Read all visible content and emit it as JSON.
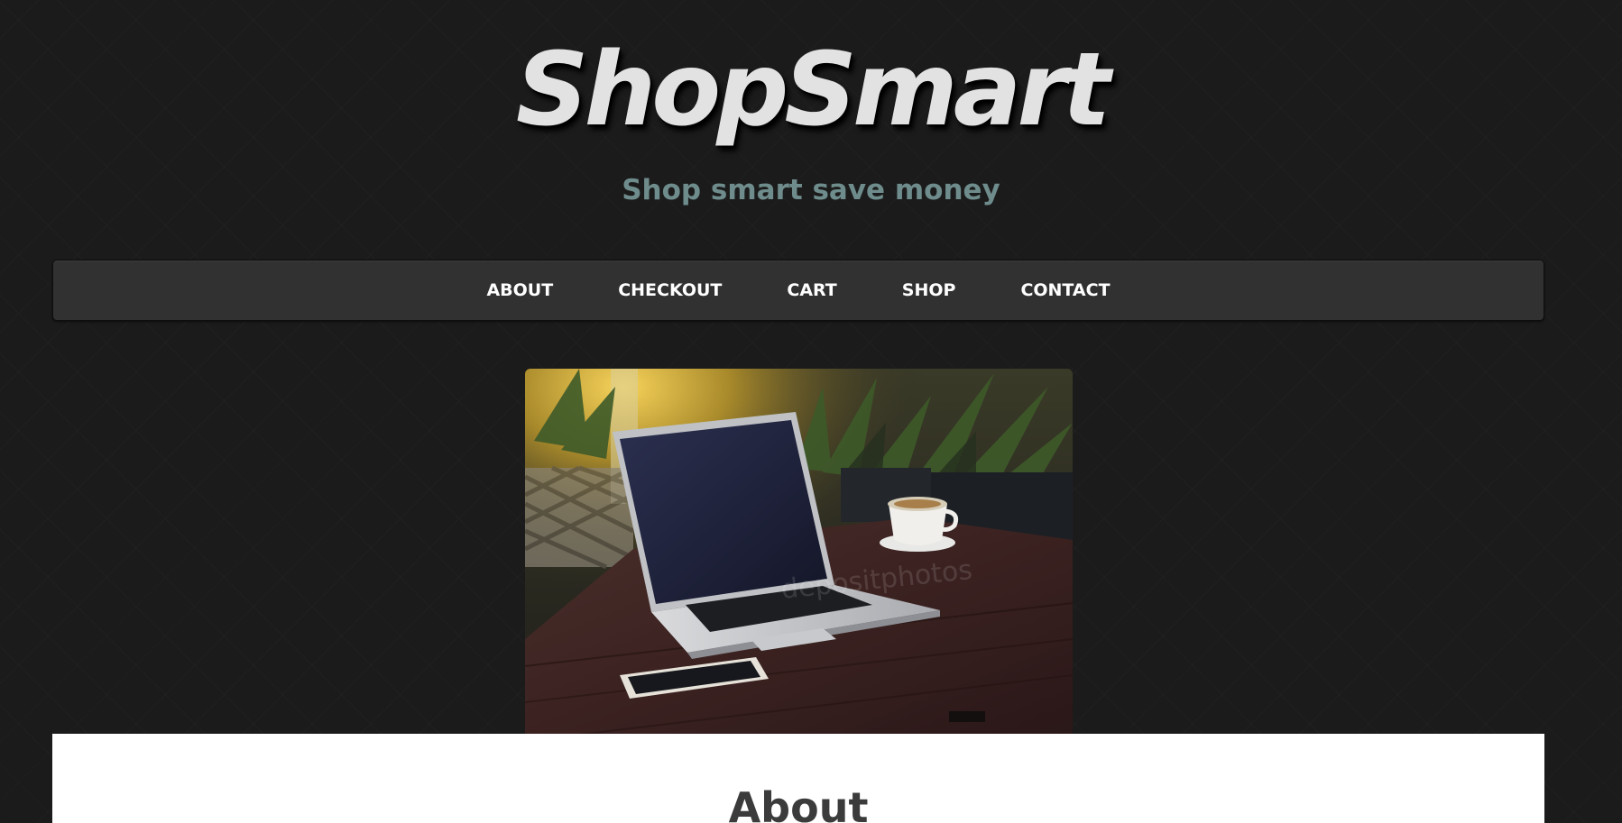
{
  "header": {
    "logo_text": "ShopSmart",
    "tagline": "Shop smart save money"
  },
  "nav": {
    "items": [
      {
        "label": "ABOUT"
      },
      {
        "label": "CHECKOUT"
      },
      {
        "label": "CART"
      },
      {
        "label": "SHOP"
      },
      {
        "label": "CONTACT"
      }
    ]
  },
  "hero": {
    "description": "laptop-on-cafe-table-photo",
    "watermark": "depositphotos"
  },
  "content": {
    "section_title": "About"
  },
  "colors": {
    "page_background": "#1b1b1b",
    "navbar_background": "#313131",
    "logo": "#e2e2e2",
    "tagline": "#6f8c8c",
    "nav_text": "#ffffff",
    "content_background": "#ffffff",
    "heading_text": "#3b3b3b"
  }
}
